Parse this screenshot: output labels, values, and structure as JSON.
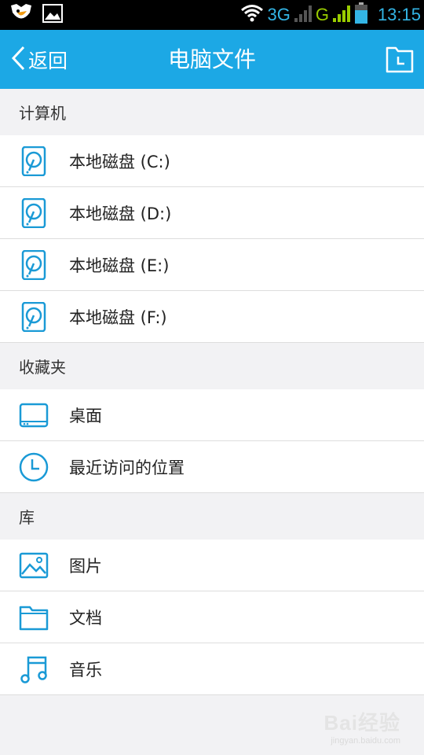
{
  "status_bar": {
    "network_3g": "3G",
    "network_g": "G",
    "time": "13:15"
  },
  "header": {
    "back_label": "返回",
    "title": "电脑文件"
  },
  "sections": [
    {
      "title": "计算机",
      "items": [
        {
          "label": "本地磁盘 (C:)",
          "icon": "hard-disk-icon"
        },
        {
          "label": "本地磁盘 (D:)",
          "icon": "hard-disk-icon"
        },
        {
          "label": "本地磁盘 (E:)",
          "icon": "hard-disk-icon"
        },
        {
          "label": "本地磁盘 (F:)",
          "icon": "hard-disk-icon"
        }
      ]
    },
    {
      "title": "收藏夹",
      "items": [
        {
          "label": "桌面",
          "icon": "desktop-icon"
        },
        {
          "label": "最近访问的位置",
          "icon": "clock-icon"
        }
      ]
    },
    {
      "title": "库",
      "items": [
        {
          "label": "图片",
          "icon": "image-icon"
        },
        {
          "label": "文档",
          "icon": "folder-icon"
        },
        {
          "label": "音乐",
          "icon": "music-note-icon"
        }
      ]
    }
  ],
  "watermark": {
    "main": "Bai经验",
    "sub": "jingyan.baidu.com"
  },
  "colors": {
    "accent": "#1ca8e5",
    "icon": "#1a9ad6",
    "status_blue": "#33b5e5",
    "status_green": "#99cc00"
  }
}
